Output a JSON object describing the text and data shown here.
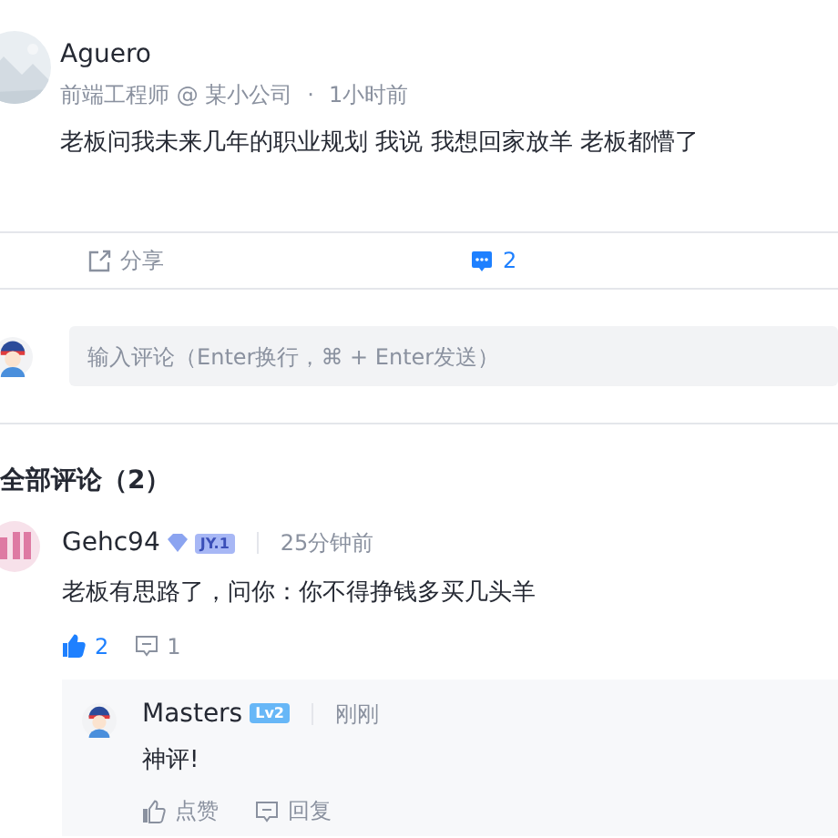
{
  "post": {
    "author": "Aguero",
    "meta": "前端工程师 @ 某小公司",
    "separator": "·",
    "time": "1小时前",
    "content": "老板问我未来几年的职业规划 我说 我想回家放羊 老板都懵了"
  },
  "actions": [
    {
      "kind": "share",
      "label": "分享",
      "selected": false
    },
    {
      "kind": "comment",
      "label": "2",
      "selected": true
    }
  ],
  "comment_input": {
    "placeholder": "输入评论（Enter换行，⌘ + Enter发送）"
  },
  "comments_heading": "全部评论（2）",
  "comments": [
    {
      "author": "Gehc94",
      "badge": "JY.1",
      "time": "25分钟前",
      "content": "老板有思路了，问你：你不得挣钱多买几头羊",
      "liked": true,
      "like_label": "2",
      "reply_label": "1",
      "replies": [
        {
          "author": "Masters",
          "badge": "Lv2",
          "time": "刚刚",
          "content": "神评!",
          "liked": false,
          "like_label": "点赞",
          "reply_label": "回复"
        }
      ]
    }
  ]
}
